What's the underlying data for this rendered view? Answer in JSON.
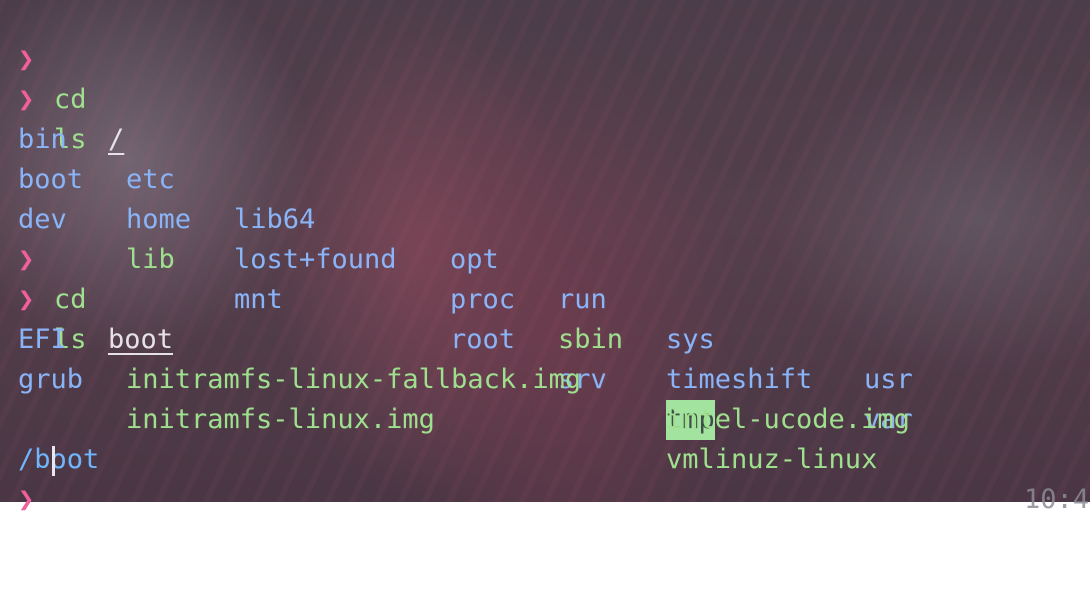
{
  "theme": {
    "prompt_color": "#f0609b",
    "command_color": "#9fe08e",
    "dir_color": "#8ab4f8",
    "file_color": "#9fe08e",
    "cwd_color": "#6fb6ff",
    "highlight_bg": "#a3e3a0"
  },
  "lines": {
    "l1": {
      "prompt": "❯",
      "cmd": "cd",
      "arg": "/"
    },
    "l2": {
      "prompt": "❯",
      "cmd": "ls"
    },
    "l3": {
      "c1": "bin",
      "c2": "etc",
      "c3": "lib64",
      "c4": "opt",
      "c5": "run",
      "c6": "sys",
      "c7": "usr"
    },
    "l4": {
      "c1": "boot",
      "c2": "home",
      "c3": "lost+found",
      "c4": "proc",
      "c5": "sbin",
      "c6": "timeshift",
      "c7": "var"
    },
    "l5": {
      "c1": "dev",
      "c2": "lib",
      "c3": "mnt",
      "c4": "root",
      "c5": "srv",
      "c6": "tmp"
    },
    "l6": {
      "prompt": "❯",
      "cmd": "cd",
      "arg": "boot"
    },
    "l7": {
      "prompt": "❯",
      "cmd": "ls"
    },
    "l8": {
      "c1": "EFI",
      "c2": "initramfs-linux-fallback.img",
      "c3": "intel-ucode.img"
    },
    "l9": {
      "c1": "grub",
      "c2": "initramfs-linux.img",
      "c3": "vmlinuz-linux"
    },
    "cwd": "/boot",
    "clock": "10:4",
    "final_prompt": "❯"
  }
}
